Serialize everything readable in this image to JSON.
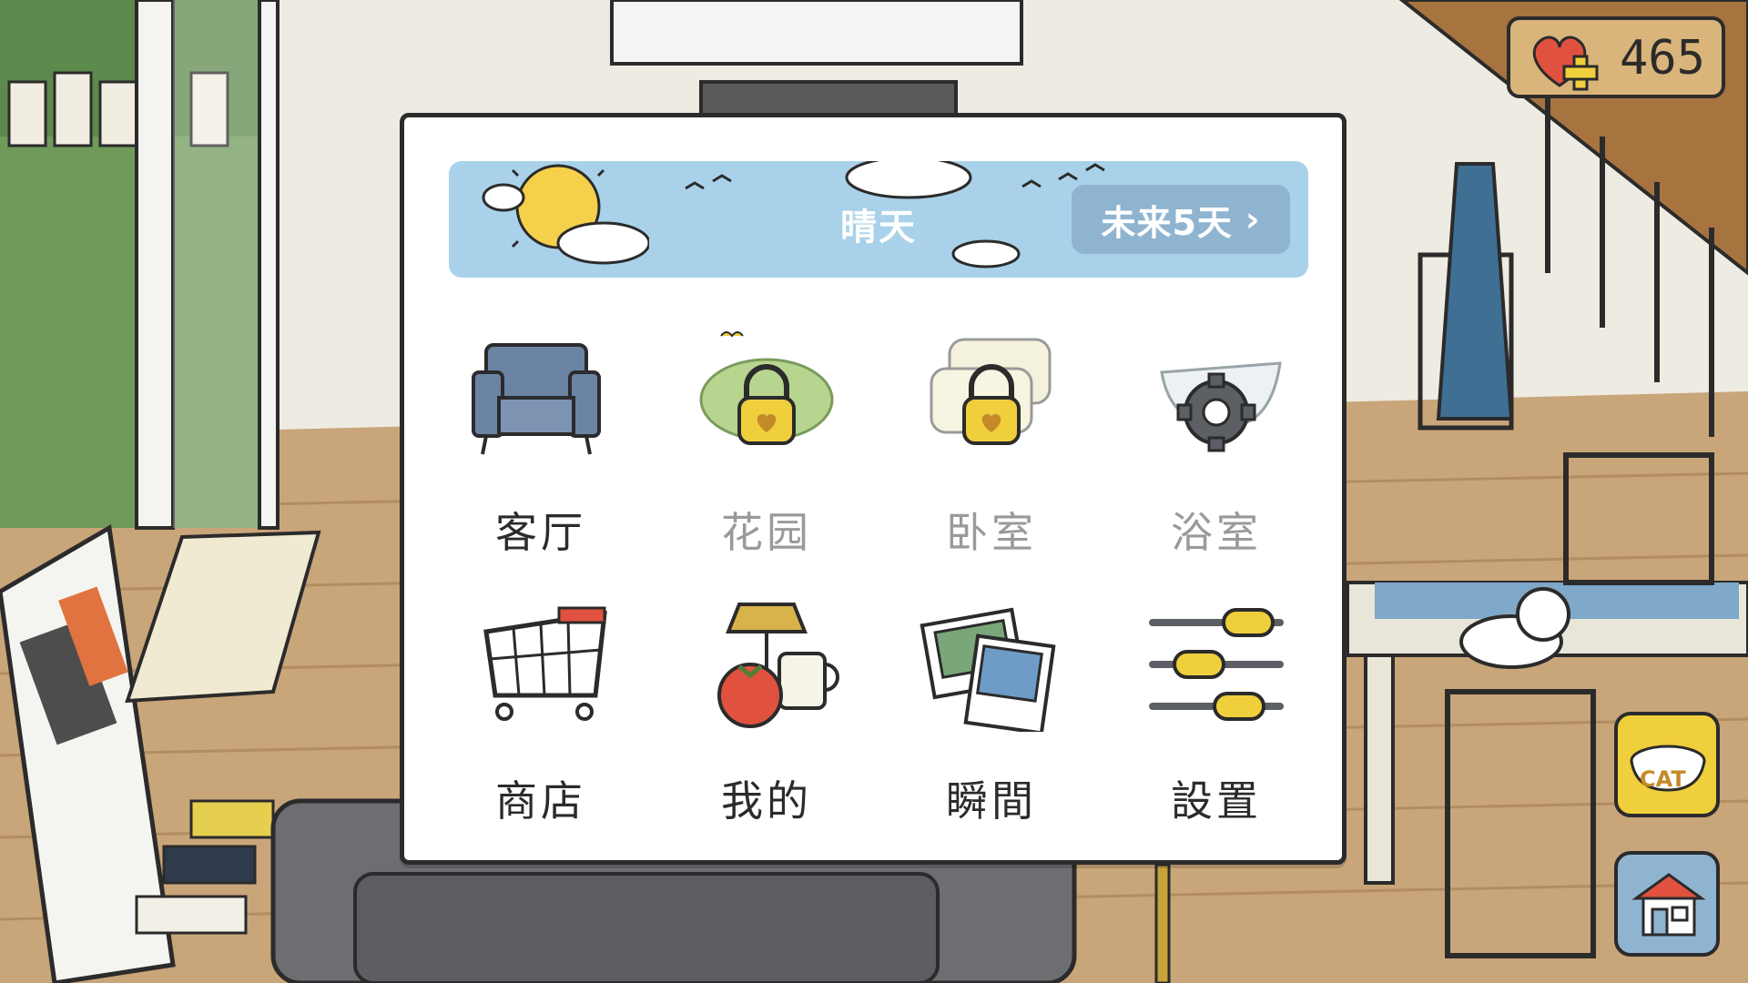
{
  "hud": {
    "hearts": "465"
  },
  "weather": {
    "condition": "晴天",
    "forecast_label": "未来5天",
    "forecast_arrow": "›"
  },
  "menu": {
    "items": [
      {
        "label": "客厅",
        "icon": "armchair-icon",
        "locked": false
      },
      {
        "label": "花园",
        "icon": "garden-lock-icon",
        "locked": true
      },
      {
        "label": "卧室",
        "icon": "pillow-lock-icon",
        "locked": true
      },
      {
        "label": "浴室",
        "icon": "bathtub-gear-icon",
        "locked": true
      },
      {
        "label": "商店",
        "icon": "shopping-cart-icon",
        "locked": false
      },
      {
        "label": "我的",
        "icon": "lamp-tomato-mug-icon",
        "locked": false
      },
      {
        "label": "瞬間",
        "icon": "photos-icon",
        "locked": false
      },
      {
        "label": "設置",
        "icon": "sliders-icon",
        "locked": false
      }
    ]
  },
  "side_buttons": {
    "cat_bowl_text": "CAT"
  },
  "colors": {
    "sky": "#a9d2ea",
    "forecast_button": "#8fb4d0",
    "lock_yellow": "#f0cf3c",
    "heart_red": "#e0523f",
    "wood_floor": "#c9a57a"
  }
}
